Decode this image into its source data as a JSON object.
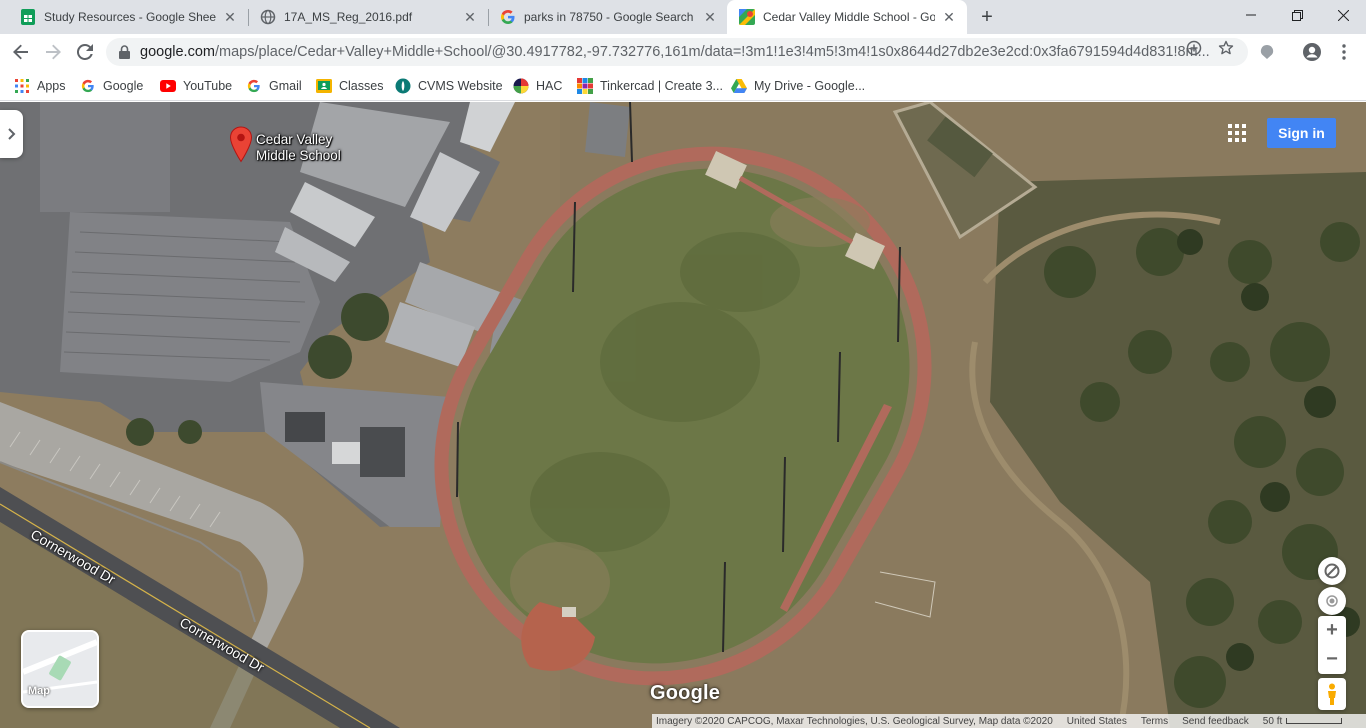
{
  "tabs": [
    {
      "title": "Study Resources - Google Sheets",
      "icon": "sheets-icon"
    },
    {
      "title": "17A_MS_Reg_2016.pdf",
      "icon": "globe-icon"
    },
    {
      "title": "parks in 78750 - Google Search",
      "icon": "google-icon"
    },
    {
      "title": "Cedar Valley Middle School - Goo",
      "icon": "maps-icon",
      "active": true
    }
  ],
  "address_bar": {
    "host": "google.com",
    "path": "/maps/place/Cedar+Valley+Middle+School/@30.4917782,-97.732776,161m/data=!3m1!1e3!4m5!3m4!1s0x8644d27db2e3e2cd:0x3fa6791594d4d831!8m..."
  },
  "bookmarks": [
    {
      "label": "Apps",
      "icon": "apps-grid-icon"
    },
    {
      "label": "Google",
      "icon": "google-icon"
    },
    {
      "label": "YouTube",
      "icon": "youtube-icon"
    },
    {
      "label": "Gmail",
      "icon": "google-icon"
    },
    {
      "label": "Classes",
      "icon": "classroom-icon"
    },
    {
      "label": "CVMS Website",
      "icon": "cvms-icon"
    },
    {
      "label": "HAC",
      "icon": "hac-icon"
    },
    {
      "label": "Tinkercad | Create 3...",
      "icon": "tinkercad-icon"
    },
    {
      "label": "My Drive - Google...",
      "icon": "drive-icon"
    }
  ],
  "map": {
    "place_label": "Cedar Valley Middle School",
    "sign_in": "Sign in",
    "minimap_label": "Map",
    "logo": "Google",
    "streets": [
      "Cornerwood Dr",
      "Cornerwood Dr"
    ],
    "footer": {
      "imagery": "Imagery ©2020 CAPCOG, Maxar Technologies, U.S. Geological Survey, Map data ©2020",
      "region": "United States",
      "terms": "Terms",
      "feedback": "Send feedback",
      "scale": "50 ft"
    }
  },
  "colors": {
    "accent": "#4285f4",
    "track": "#b9675a",
    "field": "#6e7b4c",
    "pin": "#ea4335"
  }
}
